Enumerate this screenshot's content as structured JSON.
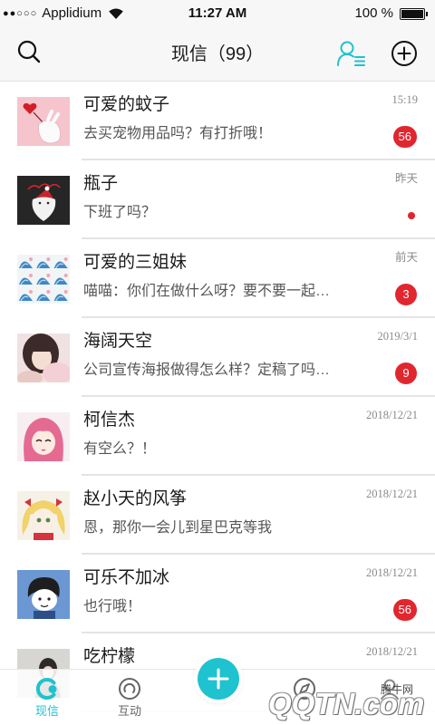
{
  "status_bar": {
    "signal": "●●○○○",
    "carrier": "Applidium",
    "time": "11:27 AM",
    "battery": "100 %",
    "icons": [
      "wifi-icon",
      "battery-icon"
    ]
  },
  "header": {
    "title": "现信（99）",
    "left_icon": "search-icon",
    "right_icons": [
      "contacts-icon",
      "add-circle-icon"
    ]
  },
  "conversations": [
    {
      "name": "可爱的蚊子",
      "message": "去买宠物用品吗？有打折哦！",
      "time": "15:19",
      "badge": "56"
    },
    {
      "name": "瓶子",
      "message": "下班了吗？",
      "time": "昨天",
      "unread_dot": true
    },
    {
      "name": "可爱的三姐妹",
      "message": "喵喵：你们在做什么呀？要不要一起…",
      "time": "前天",
      "badge": "3"
    },
    {
      "name": "海阔天空",
      "message": "公司宣传海报做得怎么样？定稿了吗…",
      "time": "2019/3/1",
      "badge": "9"
    },
    {
      "name": "柯信杰",
      "message": "有空么？！",
      "time": "2018/12/21"
    },
    {
      "name": "赵小天的风筝",
      "message": "恩，那你一会儿到星巴克等我",
      "time": "2018/12/21"
    },
    {
      "name": "可乐不加冰",
      "message": "也行哦！",
      "time": "2018/12/21",
      "badge": "56"
    },
    {
      "name": "吃柠檬",
      "time": "2018/12/21"
    }
  ],
  "tabbar": {
    "tabs": [
      {
        "label": "现信",
        "icon": "chat-icon",
        "active": true
      },
      {
        "label": "互动",
        "icon": "interaction-icon",
        "active": false
      },
      {
        "icon": "compass-icon",
        "active": false
      },
      {
        "icon": "profile-icon",
        "active": false
      }
    ],
    "center_button_icon": "plus-icon"
  },
  "watermark": {
    "cn": "腾牛网",
    "en": "QQTN.com"
  },
  "colors": {
    "accent": "#1fc2cf",
    "badge": "#e1262e",
    "header_bg": "#f7f7f7",
    "text": "#1a1a1a",
    "secondary_text": "#555555"
  }
}
